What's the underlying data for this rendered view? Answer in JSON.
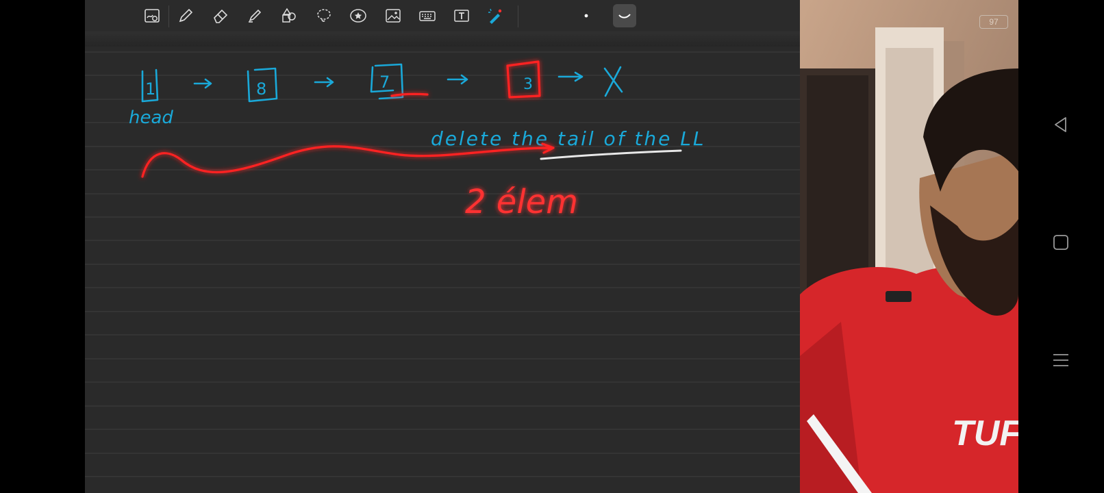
{
  "toolbar": {
    "tools": [
      {
        "icon": "zoom-scan-icon"
      },
      {
        "icon": "pen-icon"
      },
      {
        "icon": "eraser-icon"
      },
      {
        "icon": "highlighter-icon"
      },
      {
        "icon": "shapes-icon"
      },
      {
        "icon": "lasso-icon"
      },
      {
        "icon": "sticker-icon"
      },
      {
        "icon": "image-icon"
      },
      {
        "icon": "keyboard-icon"
      },
      {
        "icon": "text-box-icon"
      },
      {
        "icon": "laser-pointer-icon"
      },
      {
        "icon": "dot-size-icon"
      },
      {
        "icon": "stroke-style-icon"
      }
    ]
  },
  "note": {
    "linked_list_nodes": [
      "1",
      "8",
      "7",
      "3"
    ],
    "null_symbol": "X",
    "head_label": "head",
    "caption": "delete the tail of the LL",
    "annotation": "2 élem",
    "ink_colors": {
      "blue": "#1aa9d9",
      "red": "#ff2a2a",
      "white": "#e8e8e8"
    }
  },
  "camera": {
    "battery": "97"
  },
  "system_nav": {
    "back": "back-icon",
    "home": "home-icon",
    "menu": "menu-icon"
  }
}
